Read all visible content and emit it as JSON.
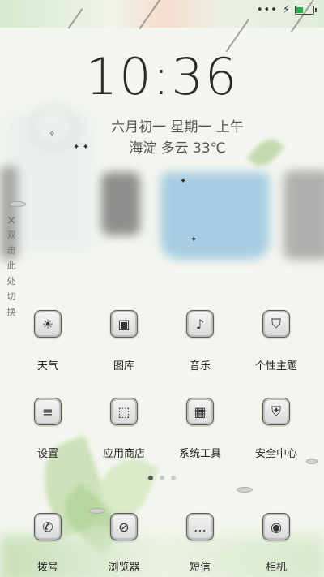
{
  "status_bar": {
    "signal": "•••",
    "charging_icon": "bolt-icon",
    "battery_level": 0.35,
    "battery_color": "#1fb24a"
  },
  "lockscreen": {
    "time": "10:36",
    "date": "六月初一   星期一 上午",
    "weather": "海淀  多云  33℃"
  },
  "side_hint": {
    "close_icon": "×",
    "chars": [
      "双",
      "击",
      "此",
      "处",
      "切",
      "换"
    ]
  },
  "apps_row1": [
    {
      "label": "天气",
      "icon": "sun-icon",
      "glyph": "☀"
    },
    {
      "label": "图库",
      "icon": "gallery-icon",
      "glyph": "▣"
    },
    {
      "label": "音乐",
      "icon": "music-note-icon",
      "glyph": "♪"
    },
    {
      "label": "个性主题",
      "icon": "tshirt-icon",
      "glyph": "⛉"
    }
  ],
  "apps_row2": [
    {
      "label": "设置",
      "icon": "settings-sliders-icon",
      "glyph": "≡"
    },
    {
      "label": "应用商店",
      "icon": "box-icon",
      "glyph": "⬚"
    },
    {
      "label": "系统工具",
      "icon": "grid-tools-icon",
      "glyph": "▦"
    },
    {
      "label": "安全中心",
      "icon": "shield-icon",
      "glyph": "⛨"
    }
  ],
  "pager": {
    "pages": 3,
    "active": 0
  },
  "dock": [
    {
      "label": "拨号",
      "icon": "phone-icon",
      "glyph": "✆"
    },
    {
      "label": "浏览器",
      "icon": "compass-icon",
      "glyph": "⊘"
    },
    {
      "label": "短信",
      "icon": "message-icon",
      "glyph": "…"
    },
    {
      "label": "相机",
      "icon": "camera-icon",
      "glyph": "◉"
    }
  ]
}
